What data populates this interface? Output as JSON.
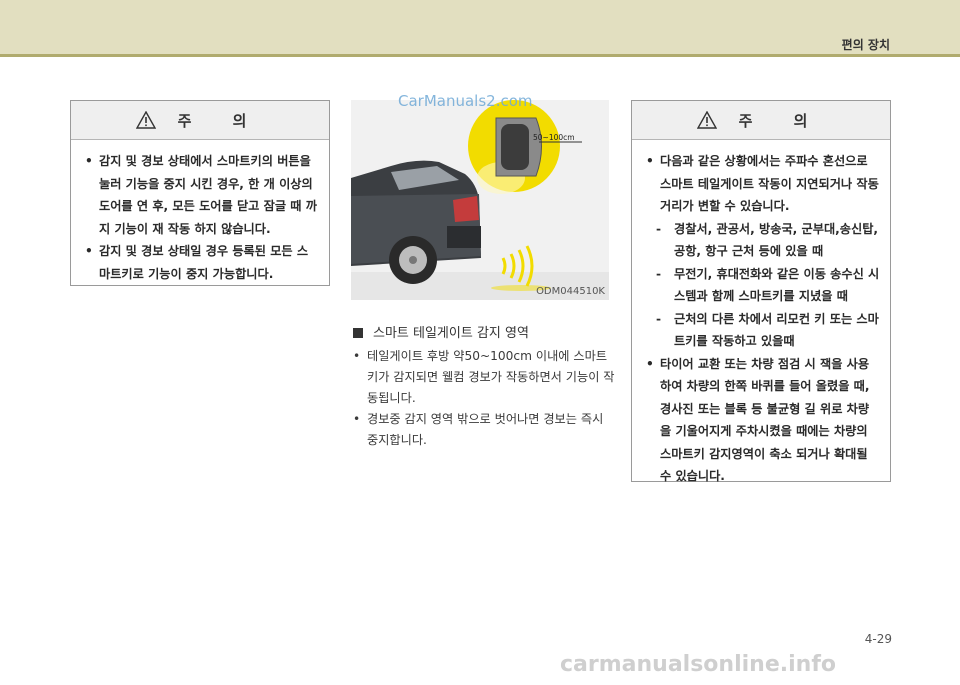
{
  "header": {
    "section_title": "편의 장치"
  },
  "left_caution": {
    "title": "주 의",
    "items": [
      "감지 및 경보 상태에서 스마트키의 버튼을 눌러 기능을 중지 시킨 경우, 한 개 이상의 도어를 연 후, 모든 도어를 닫고 잠글 때 까지 기능이 재 작동 하지 않습니다.",
      "감지 및 경보 상태일 경우 등록된 모든 스마트키로 기능이 중지 가능합니다."
    ]
  },
  "figure": {
    "distance_label": "50~100cm",
    "code": "ODM044510K"
  },
  "middle": {
    "heading": "스마트 테일게이트 감지 영역",
    "items": [
      "테일게이트 후방 약50~100cm 이내에 스마트키가 감지되면 웰컴 경보가 작동하면서 기능이 작동됩니다.",
      "경보중 감지 영역 밖으로 벗어나면 경보는 즉시 중지합니다."
    ]
  },
  "right_caution": {
    "title": "주 의",
    "item1": "다음과 같은 상황에서는 주파수 혼선으로 스마트 테일게이트 작동이 지연되거나 작동 거리가 변할 수 있습니다.",
    "subitems": [
      "경찰서, 관공서, 방송국, 군부대,송신탑, 공항, 항구 근처 등에 있을 때",
      "무전기, 휴대전화와 같은 이동 송수신 시스템과 함께 스마트키를 지녔을 때",
      "근처의 다른 차에서 리모컨 키 또는 스마트키를 작동하고 있을때"
    ],
    "item2": "타이어 교환 또는 차량 점검 시 잭을 사용하여 차량의 한쪽 바퀴를 들어 올렸을 때, 경사진 또는 블록 등 불균형 길 위로 차량을 기울어지게 주차시켰을 때에는 차량의 스마트키 감지영역이 축소 되거나 확대될 수 있습니다."
  },
  "bullet": "•",
  "dash": "-",
  "page_number": "4-29",
  "watermarks": {
    "top": "CarManuals2.com",
    "bottom": "carmanualsonline.info"
  },
  "colors": {
    "header_band": "#e2dfc0",
    "header_rule": "#b0ab6e",
    "caution_head": "#efefef",
    "detection_zone": "#f2dc00"
  }
}
